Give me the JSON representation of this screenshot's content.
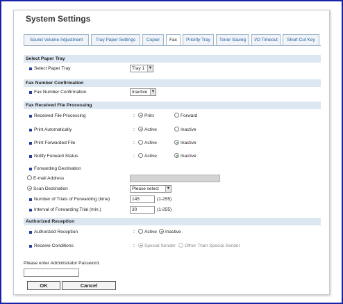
{
  "title": "System Settings",
  "tabs": [
    {
      "label": "Sound Volume Adjustment"
    },
    {
      "label": "Tray Paper Settings"
    },
    {
      "label": "Copier"
    },
    {
      "label": "Fax"
    },
    {
      "label": "Priority Tray"
    },
    {
      "label": "Toner Saving"
    },
    {
      "label": "I/O Timeout"
    },
    {
      "label": "Short Cut Key"
    }
  ],
  "active_tab": "Fax",
  "sections": {
    "paper_tray": "Select Paper Tray",
    "fax_number": "Fax Number Confirmation",
    "received": "Fax Received File Processing",
    "authorized": "Authorized Reception"
  },
  "select_paper_tray": {
    "label": "Select Paper Tray",
    "value": "Tray 1"
  },
  "fax_number_confirmation": {
    "label": "Fax Number Confirmation",
    "value": "Inactive"
  },
  "received_file_processing": {
    "label": "Received File Processing",
    "opt1": "Print",
    "opt2": "Forward",
    "selected": "Print"
  },
  "print_automatically": {
    "label": "Print Automatically",
    "opt1": "Active",
    "opt2": "Inactive",
    "selected": "Active"
  },
  "print_forwarded_file": {
    "label": "Print Forwarded File",
    "opt1": "Active",
    "opt2": "Inactive",
    "selected": "Inactive"
  },
  "notify_forward_status": {
    "label": "Notify Forward Status",
    "opt1": "Active",
    "opt2": "Inactive",
    "selected": "Inactive"
  },
  "forwarding_destination": {
    "label": "Forwarding Destination",
    "email_label": "E-mail Address",
    "email_value": "",
    "scan_label": "Scan Destination",
    "scan_value": "Please select",
    "selected": "Scan Destination"
  },
  "trials": {
    "label": "Number of Trials of Forwarding (time)",
    "value": "145",
    "range": "(1-255)"
  },
  "interval": {
    "label": "Interval of Forwarding Trial (min.)",
    "value": "30",
    "range": "(1-255)"
  },
  "authorized_reception": {
    "label": "Authorized Reception",
    "opt1": "Active",
    "opt2": "Inactive",
    "selected": "Inactive"
  },
  "receive_conditions": {
    "label": "Receive Conditions",
    "opt1": "Special Sender",
    "opt2": "Other Than Special Sender",
    "selected": "Special Sender"
  },
  "colon": ":",
  "password_prompt": "Please enter Administrator Password.",
  "buttons": {
    "ok": "OK",
    "cancel": "Cancel"
  },
  "colors": {
    "frame": "#1a22a8",
    "section_bg": "#dce7f2",
    "tab_text": "#1f5fa0"
  }
}
